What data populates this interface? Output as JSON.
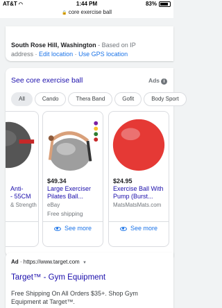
{
  "status_bar": {
    "carrier": "AT&T",
    "time": "1:44 PM",
    "battery": "83%"
  },
  "url_bar": {
    "query": "core exercise ball"
  },
  "location": {
    "place": "South Rose Hill, Washington",
    "separator": " - ",
    "based_on": "Based on IP",
    "line2_prefix": "address",
    "edit_link": "Edit location",
    "gps_link": "Use GPS location"
  },
  "shopping": {
    "title": "See core exercise ball",
    "ads_label": "Ads",
    "chips": [
      "All",
      "Cando",
      "Thera Band",
      "Gofit",
      "Body Sport"
    ],
    "products": [
      {
        "price": "",
        "name": "Anti-\n - 55CM",
        "store": "& Strength",
        "shipping": "",
        "see_more": "more"
      },
      {
        "price": "$49.34",
        "name": "Large Exerciser Pilates Ball...",
        "store": "eBay",
        "shipping": "Free shipping",
        "see_more": "See more"
      },
      {
        "price": "$24.95",
        "name": "Exercise Ball With Pump (Burst...",
        "store": "MatsMatsMats.com",
        "shipping": "",
        "see_more": "See more"
      }
    ]
  },
  "text_ad": {
    "ad_badge": "Ad",
    "url": "https://www.target.com",
    "title": "Target™ - Gym Equipment",
    "description": "Free Shipping On All Orders $35+. Shop Gym Equipment at Target™."
  },
  "colors": {
    "link": "#1a0dab",
    "accent": "#1a73e8",
    "ball_red": "#e53935",
    "ball_gray": "#9e9e9e"
  }
}
